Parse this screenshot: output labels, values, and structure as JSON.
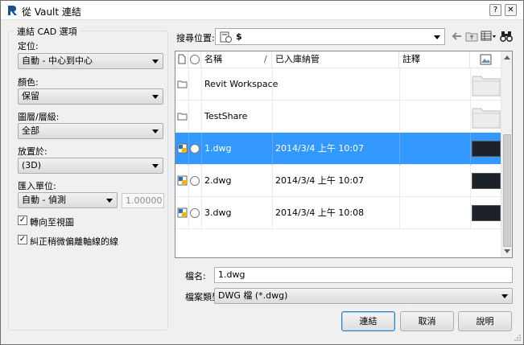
{
  "window": {
    "title": "從 Vault 連結",
    "help_glyph": "?",
    "close_glyph": "✕"
  },
  "cad_options": {
    "group_title": "連結 CAD 選項",
    "positioning_label": "定位:",
    "positioning_value": "自動 - 中心到中心",
    "colors_label": "顏色:",
    "colors_value": "保留",
    "layers_label": "圖層/層級:",
    "layers_value": "全部",
    "place_at_label": "放置於:",
    "place_at_value": "(3D)",
    "units_label": "匯入單位:",
    "units_value": "自動 - 偵測",
    "scale_value": "1.00000",
    "orient_to_view_label": "轉向至視圖",
    "orient_to_view_checked": true,
    "correct_lines_label": "糾正稍微偏離軸線的線",
    "correct_lines_checked": true,
    "check_glyph": "✓"
  },
  "look_in": {
    "label": "搜尋位置:",
    "value": "$"
  },
  "file_list": {
    "columns": [
      "名稱",
      "/",
      "已入庫納管",
      "註釋"
    ],
    "rows": [
      {
        "name": "Revit Workspace",
        "checked_in": "",
        "type": "folder",
        "selected": false
      },
      {
        "name": "TestShare",
        "checked_in": "",
        "type": "folder",
        "selected": false
      },
      {
        "name": "1.dwg",
        "checked_in": "2014/3/4 上午 10:07",
        "type": "dwg",
        "selected": true
      },
      {
        "name": "2.dwg",
        "checked_in": "2014/3/4 上午 10:07",
        "type": "dwg",
        "selected": false
      },
      {
        "name": "3.dwg",
        "checked_in": "2014/3/4 上午 10:08",
        "type": "dwg",
        "selected": false
      }
    ]
  },
  "bottom": {
    "filename_label": "檔名:",
    "filename_value": "1.dwg",
    "filetype_label": "檔案類型:",
    "filetype_value": "DWG 檔 (*.dwg)",
    "link_button": "連結",
    "cancel_button": "取消",
    "help_button": "說明"
  },
  "colors": {
    "selection": "#3399ff",
    "default_button_border": "#3c7fb1"
  }
}
